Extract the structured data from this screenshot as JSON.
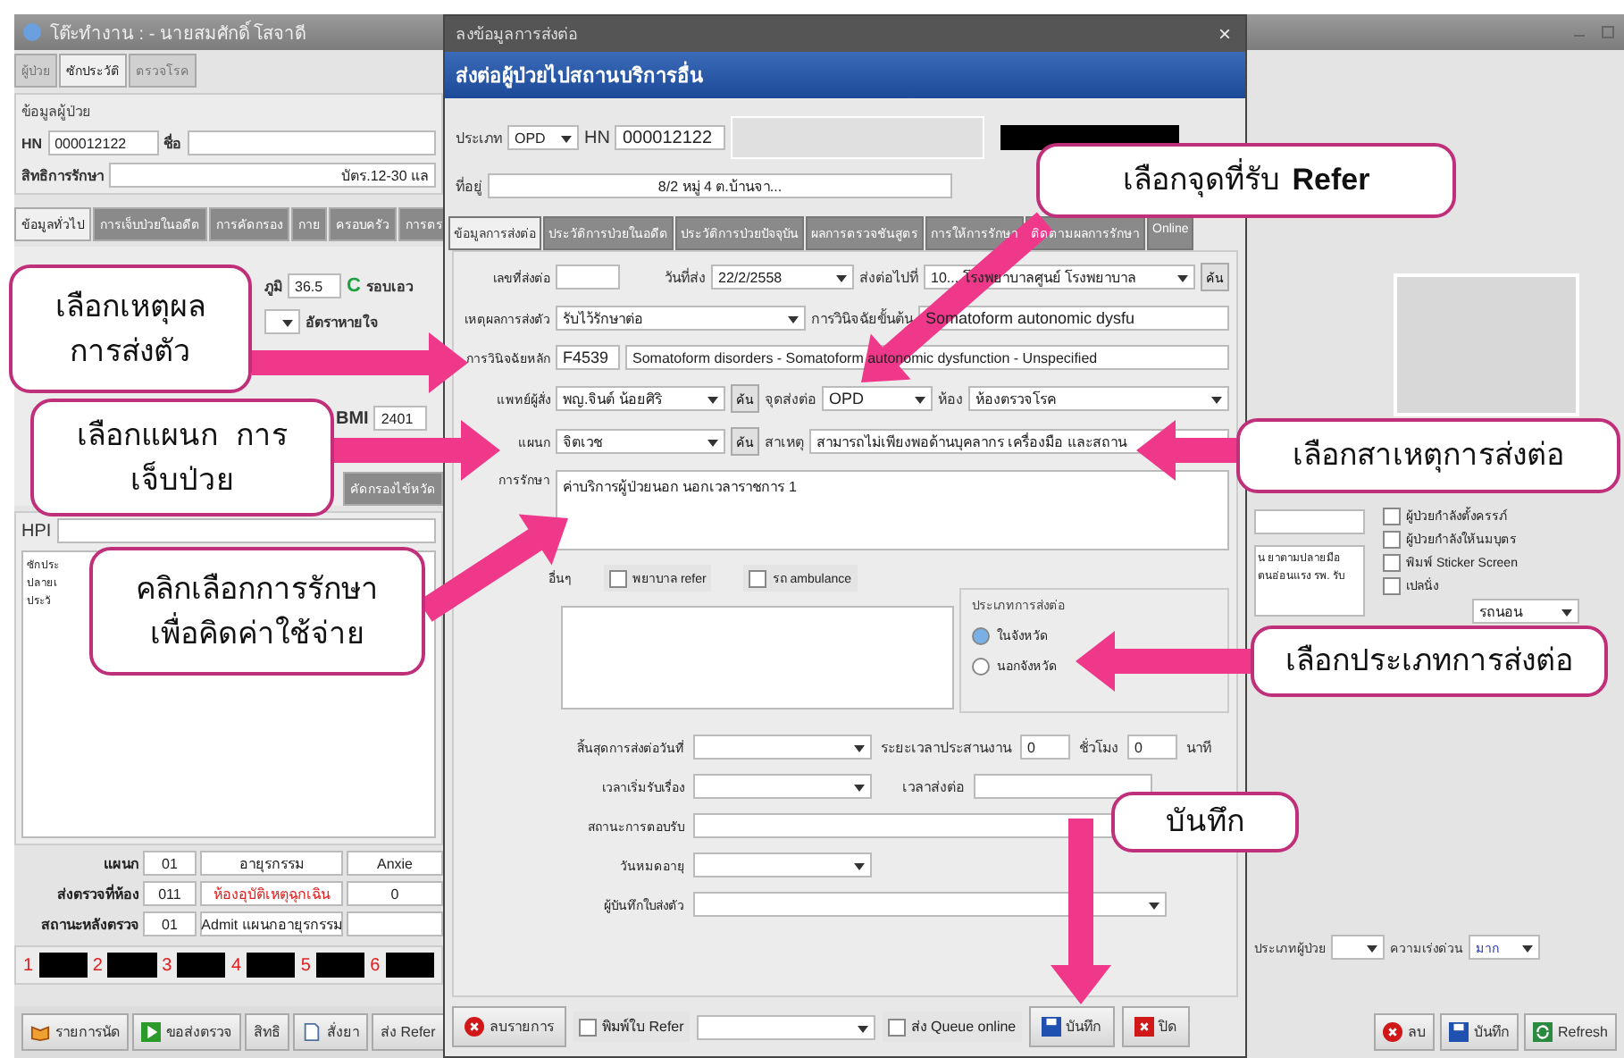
{
  "background_window": {
    "title": "โต๊ะทำงาน : - นายสมศักดิ์ โสจาดี",
    "tabs": [
      {
        "label": "ผู้ป่วย",
        "selected": false
      },
      {
        "label": "ซักประวัติ",
        "selected": true
      },
      {
        "label": "ตรวจโรค",
        "selected": false
      }
    ],
    "section_title": "ข้อมูลผู้ป่วย",
    "hn_label": "HN",
    "hn": "000012122",
    "name_label": "ชื่อ",
    "rights_label": "สิทธิการรักษา",
    "rights": "บัตร.12-30 แล",
    "info_tabs": [
      {
        "label": "ข้อมูลทั่วไป",
        "selected": true
      },
      {
        "label": "การเจ็บป่วยในอดีต",
        "selected": false
      },
      {
        "label": "การคัดกรอง",
        "selected": false
      },
      {
        "label": "กาย",
        "selected": false
      },
      {
        "label": "ครอบครัว",
        "selected": false
      },
      {
        "label": "การตร",
        "selected": false
      }
    ],
    "temp_label": "ภูมิ",
    "temp": "36.5",
    "temp_unit": "C",
    "waist_label": "รอบเอว",
    "resp_label": "อัตราหายใจ",
    "bmi_label": "BMI",
    "bmi": "2401",
    "sub_tab": "คัดกรองไข้หวัด",
    "hpi_label": "HPI",
    "notes": [
      "ซักประ",
      "ปลายเ",
      "ประวั"
    ],
    "summary_rows": [
      {
        "label": "แผนก",
        "code": "01",
        "name": "อายุรกรรม",
        "extra": "Anxie",
        "alert": false
      },
      {
        "label": "ส่งตรวจที่ห้อง",
        "code": "011",
        "name": "ห้องอุบัติเหตุฉุกเฉิน",
        "extra": "0",
        "alert": true
      },
      {
        "label": "สถานะหลังตรวจ",
        "code": "01",
        "name": "Admit แผนกอายุรกรรม",
        "alert": false
      }
    ],
    "slots": [
      "1",
      "2",
      "3",
      "4",
      "5",
      "6"
    ],
    "buttons": [
      "รายการนัด",
      "ขอส่งตรวจ",
      "สิทธิ",
      "สั่งยา",
      "ส่ง Refer"
    ],
    "right_notes": [
      "น ยาตามปลายมือ",
      "ตนอ่อนแรง รพ. รับ"
    ],
    "right_checks": [
      {
        "label": "ผู้ป่วยกำลังตั้งครรภ์",
        "checked": false
      },
      {
        "label": "ผู้ป่วยกำลังให้นมบุตร",
        "checked": false
      },
      {
        "label": "พิมพ์ Sticker Screen",
        "checked": false
      },
      {
        "label": "เปลนั่ง",
        "checked": false
      }
    ],
    "transport": "รถนอน",
    "patient_type_label": "ประเภทผู้ป่วย",
    "urgency_label": "ความเร่งด่วน",
    "urgency": "มาก",
    "right_buttons": [
      "ลบ",
      "บันทึก",
      "Refresh"
    ]
  },
  "dialog": {
    "title": "ลงข้อมูลการส่งต่อ",
    "close": "×",
    "header": "ส่งต่อผู้ป่วยไปสถานบริการอื่น",
    "type_label": "ประเภท",
    "type": "OPD",
    "hn_label": "HN",
    "hn": "000012122",
    "address_label": "ที่อยู่",
    "address": "8/2 หมู่ 4 ต.บ้านจา...",
    "tabs": [
      {
        "label": "ข้อมูลการส่งต่อ",
        "selected": true
      },
      {
        "label": "ประวัติการป่วยในอดีต",
        "selected": false
      },
      {
        "label": "ประวัติการป่วยปัจจุบัน",
        "selected": false
      },
      {
        "label": "ผลการตรวจชันสูตร",
        "selected": false
      },
      {
        "label": "การให้การรักษา",
        "selected": false
      },
      {
        "label": "ติดตามผลการรักษา",
        "selected": false
      },
      {
        "label": "Online",
        "selected": false
      }
    ],
    "refer_no_label": "เลขที่ส่งต่อ",
    "date_label": "วันที่ส่ง",
    "date": "22/2/2558",
    "dest_label": "ส่งต่อไปที่",
    "dest": "10... โรงพยาบาลศูนย์ โรงพยาบาล",
    "dest_search": "ค้น",
    "reason_label": "เหตุผลการส่งตัว",
    "reason": "รับไว้รักษาต่อ",
    "initial_dx_label": "การวินิจฉัยขั้นต้น",
    "initial_dx": "Somatoform autonomic dysfu",
    "main_dx_label": "การวินิจฉัยหลัก",
    "main_dx_code": "F4539",
    "main_dx": "Somatoform disorders - Somatoform autonomic dysfunction - Unspecified",
    "doctor_label": "แพทย์ผู้สั่ง",
    "doctor": "พญ.จินต์  น้อยศิริ",
    "doctor_search": "ค้น",
    "point_label": "จุดส่งต่อ",
    "point": "OPD",
    "room_label": "ห้อง",
    "room": "ห้องตรวจโรค",
    "dept_label": "แผนก",
    "dept": "จิตเวช",
    "dept_search": "ค้น",
    "cause_label": "สาเหตุ",
    "cause": "สามารถไม่เพียงพอด้านบุคลากร เครื่องมือ และสถาน",
    "treatment_label": "การรักษา",
    "treatment": "ค่าบริการผู้ป่วยนอก นอกเวลาราชการ 1",
    "other_label": "อื่นๆ",
    "other_checks": [
      {
        "label": "พยาบาล refer",
        "checked": false
      },
      {
        "label": "รถ ambulance",
        "checked": false
      }
    ],
    "refer_type_label": "ประเภทการส่งต่อ",
    "refer_types": [
      {
        "label": "ในจังหวัด",
        "selected": true
      },
      {
        "label": "นอกจังหวัด",
        "selected": false
      }
    ],
    "end_date_label": "สิ้นสุดการส่งต่อวันที่",
    "coord_label": "ระยะเวลาประสานงาน",
    "hours": "0",
    "hours_label": "ชั่วโมง",
    "minutes": "0",
    "minutes_label": "นาที",
    "start_time_label": "เวลาเริ่มรับเรื่อง",
    "send_time_label": "เวลาส่งต่อ",
    "status_label": "สถานะการตอบรับ",
    "expire_label": "วันหมดอายุ",
    "recorder_label": "ผู้บันทึกใบส่งตัว",
    "delete_button": "ลบรายการ",
    "print_check": {
      "label": "พิมพ์ใบ Refer",
      "checked": false
    },
    "queue_check": {
      "label": "ส่ง Queue online",
      "checked": false
    },
    "save_button": "บันทึก",
    "close_button": "ปิด"
  },
  "callouts": [
    "เลือกเหตุผล การส่งตัว",
    "เลือกแผนก การ เจ็บป่วย",
    "คลิกเลือกการรักษา เพื่อคิดค่าใช้จ่าย",
    "เลือกจุดที่รับ **Refer**",
    "เลือกสาเหตุการส่งต่อ",
    "เลือกประเภทการส่งต่อ",
    "บันทึก"
  ]
}
